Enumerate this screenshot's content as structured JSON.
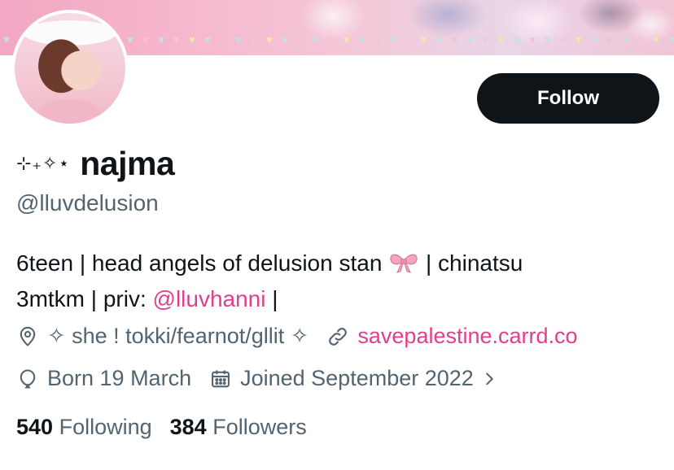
{
  "profile": {
    "name_decoration": "⊹₊✧⋆",
    "display_name": "najma",
    "handle": "@lluvdelusion",
    "bio": {
      "line1_text": "6teen | head angels of delusion stan ",
      "line1_emoji": "ribbon-emoji",
      "line1_tail": " | chinatsu",
      "line2_prefix": "3mtkm | priv: ",
      "mention": "@lluvhanni",
      "line2_suffix": " |"
    },
    "location": "✧ she ! tokki/fearnot/gllit ✧",
    "website": "savepalestine.carrd.co",
    "birthday": "Born 19 March",
    "joined": "Joined September 2022",
    "following_count": "540",
    "following_label": "Following",
    "followers_count": "384",
    "followers_label": "Followers"
  },
  "actions": {
    "follow_label": "Follow"
  },
  "colors": {
    "accent_link": "#e0408a",
    "secondary_text": "#536471",
    "button_bg": "#0f1419"
  }
}
